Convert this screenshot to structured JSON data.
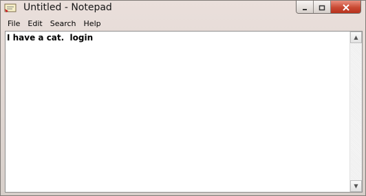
{
  "window": {
    "title": "Untitled - Notepad"
  },
  "menu": {
    "file": "File",
    "edit": "Edit",
    "search": "Search",
    "help": "Help"
  },
  "editor": {
    "text": "I have a cat.  login"
  },
  "icons": {
    "app": "notepad-icon",
    "minimize": "minimize-icon",
    "maximize": "maximize-icon",
    "close": "close-icon",
    "scroll_up": "scroll-up-icon",
    "scroll_down": "scroll-down-icon"
  }
}
